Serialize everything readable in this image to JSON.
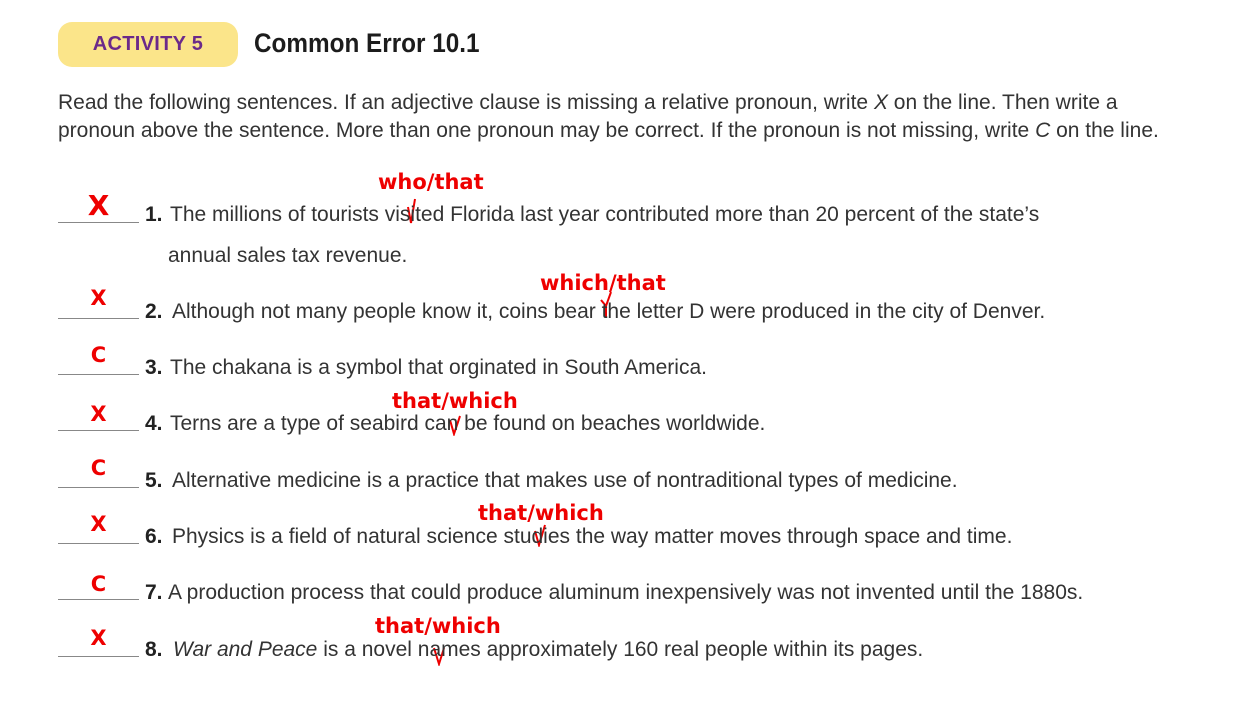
{
  "header": {
    "activity_label": "ACTIVITY 5",
    "title": "Common Error 10.1"
  },
  "instructions": {
    "part1": "Read the following sentences. If an adjective clause is missing a relative pronoun, write ",
    "x_mark": "X",
    "part2": " on the line. Then write a pronoun above the sentence. More than one pronoun may be correct. If the pronoun is not missing, write ",
    "c_mark": "C",
    "part3": " on the line."
  },
  "exercises": [
    {
      "number": "1.",
      "answer": "X",
      "inserted": "who/that",
      "text_line1": "The millions of tourists visited Florida last year contributed more than 20 percent of the state’s",
      "text_line2": "annual sales tax revenue."
    },
    {
      "number": "2.",
      "answer": "X",
      "inserted": "which/that",
      "text": "Although not many people know it, coins bear the letter D were produced in the city of Denver."
    },
    {
      "number": "3.",
      "answer": "C",
      "text": "The chakana is a symbol that orginated in South America."
    },
    {
      "number": "4.",
      "answer": "X",
      "inserted": "that/which",
      "text": "Terns are a type of seabird can be found on beaches worldwide."
    },
    {
      "number": "5.",
      "answer": "C",
      "text": "Alternative medicine is a practice that makes use of nontraditional types of medicine."
    },
    {
      "number": "6.",
      "answer": "X",
      "inserted": "that/which",
      "text": "Physics is a field of natural science studies the way matter moves through space and time."
    },
    {
      "number": "7.",
      "answer": "C",
      "text": "A production process that could produce aluminum inexpensively was not invented until the 1880s."
    },
    {
      "number": "8.",
      "answer": "X",
      "inserted": "that/which",
      "text_italic": "War and Peace",
      "text": " is a novel names approximately 160 real people within its pages."
    }
  ],
  "colors": {
    "badge_bg": "#fbe58a",
    "badge_text": "#6b2a8a",
    "annotation": "#ee0000"
  }
}
